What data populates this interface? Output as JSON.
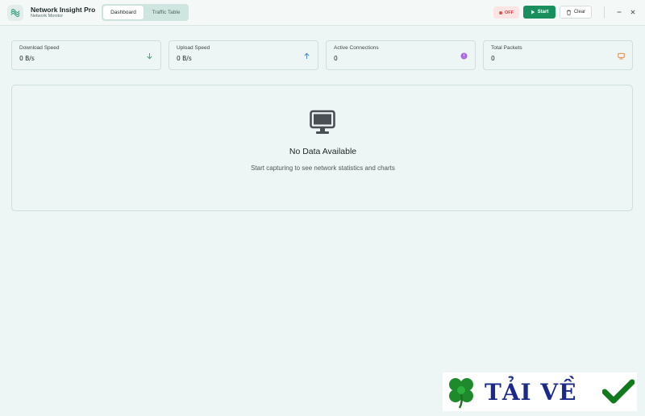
{
  "app": {
    "title": "Network Insight Pro",
    "subtitle": "Network Monitor",
    "logo_icon": "network-logo-icon"
  },
  "tabs": [
    {
      "label": "Dashboard",
      "active": true
    },
    {
      "label": "Traffic Table",
      "active": false
    }
  ],
  "toolbar": {
    "status_label": "OFF",
    "start_label": "Start",
    "clear_label": "Clear"
  },
  "window_controls": {
    "minimize_icon": "minimize-icon",
    "close_icon": "close-icon"
  },
  "stats": [
    {
      "label": "Download Speed",
      "value": "0 B/s",
      "icon": "arrow-down-icon",
      "color": "#2fa86b"
    },
    {
      "label": "Upload Speed",
      "value": "0 B/s",
      "icon": "arrow-up-icon",
      "color": "#3b82c4"
    },
    {
      "label": "Active Connections",
      "value": "0",
      "icon": "connections-icon",
      "color": "#a56be0"
    },
    {
      "label": "Total Packets",
      "value": "0",
      "icon": "packets-icon",
      "color": "#e07b2c"
    }
  ],
  "empty_state": {
    "icon": "monitor-icon",
    "title": "No Data Available",
    "description": "Start capturing to see network statistics and charts"
  },
  "watermark": {
    "text": "TẢI VỀ",
    "icons": [
      "clover-icon",
      "checkmark-icon"
    ]
  },
  "colors": {
    "accent": "#1a8f5e",
    "status_off": "#d23b3b",
    "background": "#eef5f5"
  }
}
